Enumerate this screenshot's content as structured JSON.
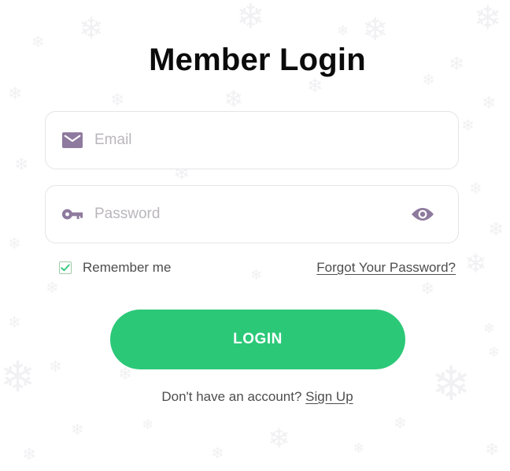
{
  "title": "Member Login",
  "email": {
    "placeholder": "Email",
    "value": "",
    "icon": "envelope-icon"
  },
  "password": {
    "placeholder": "Password",
    "value": "",
    "icon": "key-icon",
    "toggle_icon": "eye-icon"
  },
  "remember": {
    "label": "Remember me",
    "checked": true
  },
  "forgot_link": "Forgot Your Password?",
  "login_button": "LOGIN",
  "signup": {
    "prompt": "Don't have an account?",
    "link": "Sign Up"
  },
  "colors": {
    "accent": "#2bc878",
    "icon": "#8e7a9e",
    "text": "#4d4d4f",
    "title": "#0b0b0b",
    "placeholder": "#b9b6bd"
  }
}
